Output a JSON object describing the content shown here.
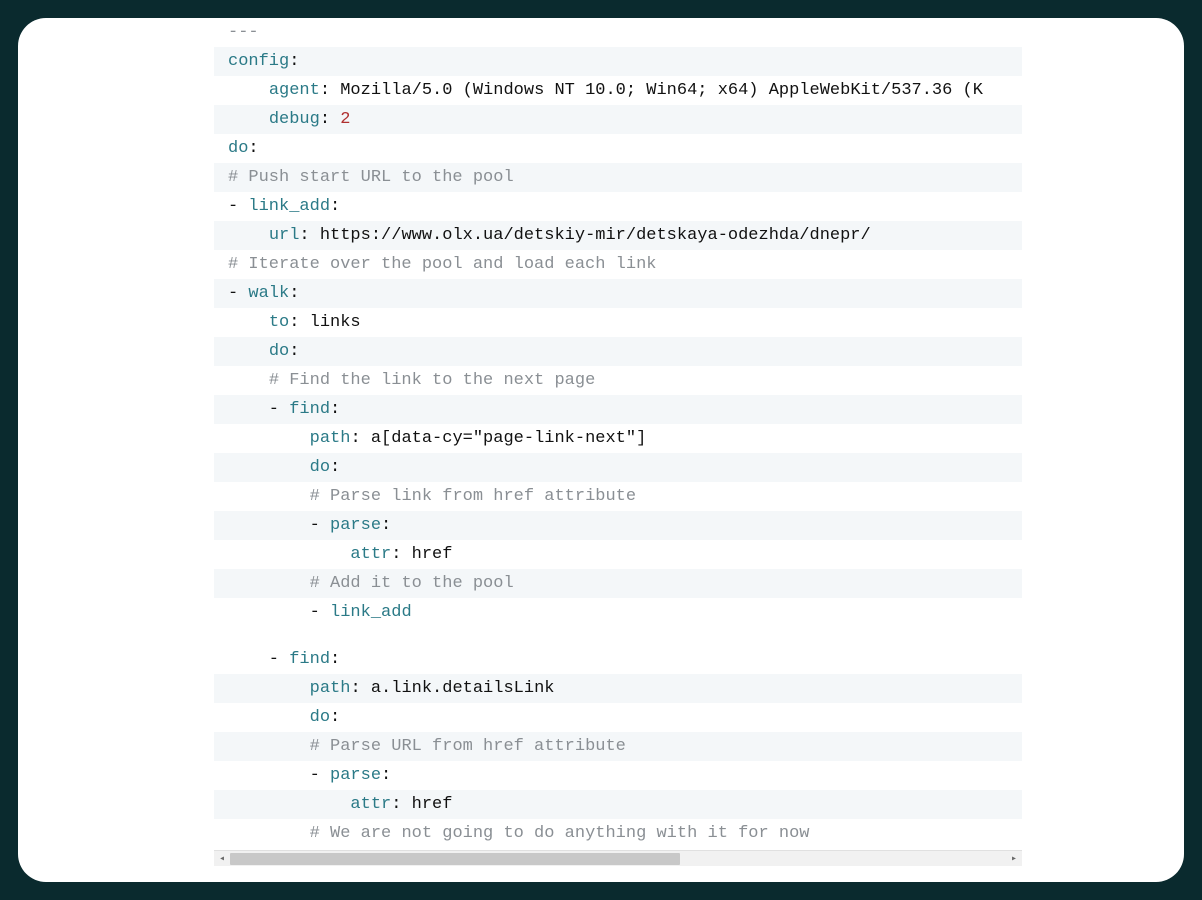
{
  "code": {
    "lines": [
      {
        "striped": false,
        "segments": [
          {
            "cls": "d",
            "text": "---"
          }
        ]
      },
      {
        "striped": true,
        "segments": [
          {
            "cls": "k",
            "text": "config"
          },
          {
            "cls": "v",
            "text": ":"
          }
        ]
      },
      {
        "striped": false,
        "segments": [
          {
            "cls": "v",
            "text": "    "
          },
          {
            "cls": "k",
            "text": "agent"
          },
          {
            "cls": "v",
            "text": ": Mozilla/5.0 (Windows NT 10.0; Win64; x64) AppleWebKit/537.36 (K"
          }
        ]
      },
      {
        "striped": true,
        "segments": [
          {
            "cls": "v",
            "text": "    "
          },
          {
            "cls": "k",
            "text": "debug"
          },
          {
            "cls": "v",
            "text": ": "
          },
          {
            "cls": "n",
            "text": "2"
          }
        ]
      },
      {
        "striped": false,
        "segments": [
          {
            "cls": "k",
            "text": "do"
          },
          {
            "cls": "v",
            "text": ":"
          }
        ]
      },
      {
        "striped": true,
        "segments": [
          {
            "cls": "c",
            "text": "# Push start URL to the pool"
          }
        ]
      },
      {
        "striped": false,
        "segments": [
          {
            "cls": "v",
            "text": "- "
          },
          {
            "cls": "k",
            "text": "link_add"
          },
          {
            "cls": "v",
            "text": ":"
          }
        ]
      },
      {
        "striped": true,
        "segments": [
          {
            "cls": "v",
            "text": "    "
          },
          {
            "cls": "k",
            "text": "url"
          },
          {
            "cls": "v",
            "text": ": https://www.olx.ua/detskiy-mir/detskaya-odezhda/dnepr/"
          }
        ]
      },
      {
        "striped": false,
        "segments": [
          {
            "cls": "c",
            "text": "# Iterate over the pool and load each link"
          }
        ]
      },
      {
        "striped": true,
        "segments": [
          {
            "cls": "v",
            "text": "- "
          },
          {
            "cls": "k",
            "text": "walk"
          },
          {
            "cls": "v",
            "text": ":"
          }
        ]
      },
      {
        "striped": false,
        "segments": [
          {
            "cls": "v",
            "text": "    "
          },
          {
            "cls": "k",
            "text": "to"
          },
          {
            "cls": "v",
            "text": ": links"
          }
        ]
      },
      {
        "striped": true,
        "segments": [
          {
            "cls": "v",
            "text": "    "
          },
          {
            "cls": "k",
            "text": "do"
          },
          {
            "cls": "v",
            "text": ":"
          }
        ]
      },
      {
        "striped": false,
        "segments": [
          {
            "cls": "v",
            "text": "    "
          },
          {
            "cls": "c",
            "text": "# Find the link to the next page"
          }
        ]
      },
      {
        "striped": true,
        "segments": [
          {
            "cls": "v",
            "text": "    - "
          },
          {
            "cls": "k",
            "text": "find"
          },
          {
            "cls": "v",
            "text": ":"
          }
        ]
      },
      {
        "striped": false,
        "segments": [
          {
            "cls": "v",
            "text": "        "
          },
          {
            "cls": "k",
            "text": "path"
          },
          {
            "cls": "v",
            "text": ": a[data-cy=\"page-link-next\"]"
          }
        ]
      },
      {
        "striped": true,
        "segments": [
          {
            "cls": "v",
            "text": "        "
          },
          {
            "cls": "k",
            "text": "do"
          },
          {
            "cls": "v",
            "text": ":"
          }
        ]
      },
      {
        "striped": false,
        "segments": [
          {
            "cls": "v",
            "text": "        "
          },
          {
            "cls": "c",
            "text": "# Parse link from href attribute"
          }
        ]
      },
      {
        "striped": true,
        "segments": [
          {
            "cls": "v",
            "text": "        - "
          },
          {
            "cls": "k",
            "text": "parse"
          },
          {
            "cls": "v",
            "text": ":"
          }
        ]
      },
      {
        "striped": false,
        "segments": [
          {
            "cls": "v",
            "text": "            "
          },
          {
            "cls": "k",
            "text": "attr"
          },
          {
            "cls": "v",
            "text": ": href"
          }
        ]
      },
      {
        "striped": true,
        "segments": [
          {
            "cls": "v",
            "text": "        "
          },
          {
            "cls": "c",
            "text": "# Add it to the pool"
          }
        ]
      },
      {
        "striped": false,
        "segments": [
          {
            "cls": "v",
            "text": "        - "
          },
          {
            "cls": "k",
            "text": "link_add"
          }
        ]
      },
      {
        "blank": true
      },
      {
        "striped": false,
        "segments": [
          {
            "cls": "v",
            "text": "    - "
          },
          {
            "cls": "k",
            "text": "find"
          },
          {
            "cls": "v",
            "text": ":"
          }
        ]
      },
      {
        "striped": true,
        "segments": [
          {
            "cls": "v",
            "text": "        "
          },
          {
            "cls": "k",
            "text": "path"
          },
          {
            "cls": "v",
            "text": ": a.link.detailsLink"
          }
        ]
      },
      {
        "striped": false,
        "segments": [
          {
            "cls": "v",
            "text": "        "
          },
          {
            "cls": "k",
            "text": "do"
          },
          {
            "cls": "v",
            "text": ":"
          }
        ]
      },
      {
        "striped": true,
        "segments": [
          {
            "cls": "v",
            "text": "        "
          },
          {
            "cls": "c",
            "text": "# Parse URL from href attribute"
          }
        ]
      },
      {
        "striped": false,
        "segments": [
          {
            "cls": "v",
            "text": "        - "
          },
          {
            "cls": "k",
            "text": "parse"
          },
          {
            "cls": "v",
            "text": ":"
          }
        ]
      },
      {
        "striped": true,
        "segments": [
          {
            "cls": "v",
            "text": "            "
          },
          {
            "cls": "k",
            "text": "attr"
          },
          {
            "cls": "v",
            "text": ": href"
          }
        ]
      },
      {
        "striped": false,
        "segments": [
          {
            "cls": "v",
            "text": "        "
          },
          {
            "cls": "c",
            "text": "# We are not going to do anything with it for now"
          }
        ]
      }
    ]
  },
  "scrollbar": {
    "left_arrow": "◂",
    "right_arrow": "▸"
  }
}
